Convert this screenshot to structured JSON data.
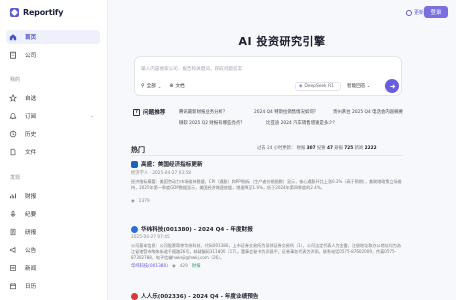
{
  "app": {
    "name": "Reportify"
  },
  "header": {
    "lang": "更新",
    "login": "登录"
  },
  "sidebar": {
    "top_items": [
      {
        "label": "首页"
      },
      {
        "label": "公司"
      }
    ],
    "section1": "我的",
    "mine": [
      {
        "label": "自选"
      },
      {
        "label": "订阅"
      },
      {
        "label": "历史"
      },
      {
        "label": "文件"
      }
    ],
    "section2": "发现",
    "discover": [
      {
        "label": "财报"
      },
      {
        "label": "纪要"
      },
      {
        "label": "研报"
      },
      {
        "label": "公告"
      },
      {
        "label": "新闻"
      },
      {
        "label": "日历"
      }
    ]
  },
  "main": {
    "title": "AI 投资研究引擎",
    "search": {
      "placeholder": "输入内容搜索公司、报告和关键词，获取问题答案",
      "opt_all": "全部",
      "opt_doc": "文档",
      "model": "DeepSeek R1",
      "smart": "智能回答"
    },
    "recommend": {
      "label": "问题推荐",
      "questions": [
        "腾讯最新财报业务分析？",
        "2024 Q4 特斯拉销售情况如何？",
        "贵州茅台 2025 Q4 电话会内容摘要",
        "微软 2025 Q2 财报有哪些亮点？",
        "比亚迪 2024 汽车销售增速是多少？"
      ]
    },
    "hot": {
      "title": "热门",
      "stats_prefix": "过去 24 小时更新：",
      "stats": [
        {
          "label": "财报",
          "value": "307"
        },
        {
          "label": "纪要",
          "value": "47"
        },
        {
          "label": "研报",
          "value": "725"
        },
        {
          "label": "新闻",
          "value": "2222"
        }
      ]
    },
    "cards": [
      {
        "title": "高盛：美国经济指标更新",
        "date": "经济学人 · 2025-04-27 03:58",
        "body": "经济指标摘要：美国劳动力市场维持稳健，CPI（通胀）和PPI指标（生产者价格指数）显示，核心通胀环比上涨0.3%（高于预期），美联储政策立场维持，2025年第一季度GDP数据显示，美国经济增速放缓，增速降至1.6%，低于2024年第四季度的2.4%。",
        "foot": "2379"
      },
      {
        "title": "华纬科技(001380) - 2024 Q4 - 年度财报",
        "date": "2025-04-27 07:45",
        "body": "公司基本信息：公司股票简称华纬科技，代码001380，上市证券交易所为深圳证券交易所（1）。公司法定代表人为金雷，注册地址和办公地址均为浙江省诸暨市陶朱街道千禧路26号，邮政编码311800（17）。董事会秘书为邓昌平，证券事务代表为洪雨，联系电话0575-87602009，传真0575-87302788，电子信箱hwkeji@hwkj.com（26）。",
        "tag": "华纬科技(001380)",
        "foot": "429",
        "foot2": "财报"
      },
      {
        "title": "人人乐(002336) - 2024 Q4 - 年度业绩预告"
      }
    ]
  }
}
